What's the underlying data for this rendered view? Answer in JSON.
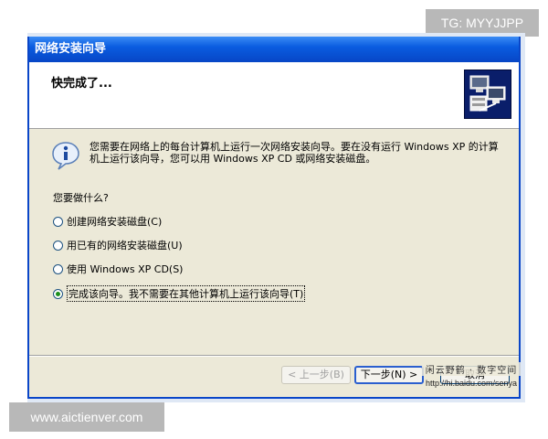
{
  "watermarks": {
    "top": "TG: MYYJJPP",
    "bottom": "www.aictienver.com"
  },
  "window": {
    "title": "网络安装向导"
  },
  "header": {
    "title": "快完成了..."
  },
  "message": "您需要在网络上的每台计算机上运行一次网络安装向导。要在没有运行 Windows XP 的计算机上运行该向导，您可以用 Windows XP CD 或网络安装磁盘。",
  "question": "您要做什么?",
  "options": [
    {
      "label": "创建网络安装磁盘(C)",
      "checked": false
    },
    {
      "label": "用已有的网络安装磁盘(U)",
      "checked": false
    },
    {
      "label": "使用 Windows XP CD(S)",
      "checked": false
    },
    {
      "label": "完成该向导。我不需要在其他计算机上运行该向导(T)",
      "checked": true
    }
  ],
  "buttons": {
    "back": "< 上一步(B)",
    "next": "下一步(N) >",
    "cancel": "取消"
  },
  "signature": {
    "text": "闲云野鹤 · 数字空间",
    "url": "http://hi.baidu.com/senya"
  },
  "colors": {
    "titlebar": "#0a5ce0",
    "dialog_bg": "#ece9d8"
  },
  "icons": {
    "info": "info-icon",
    "wizard": "network-computers-icon"
  }
}
